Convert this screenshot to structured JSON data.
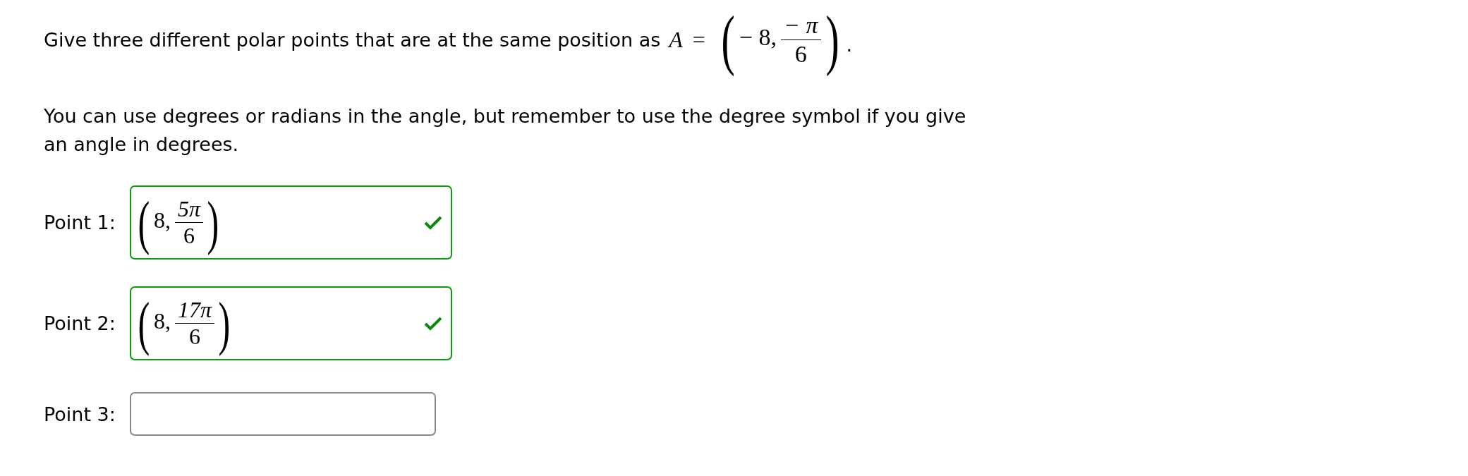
{
  "question": {
    "text": "Give three different polar points that are at the same position as",
    "math": {
      "variable": "A",
      "relation": "=",
      "open": "(",
      "before": "− 8,",
      "numerator": "− π",
      "denominator": "6",
      "close": ")"
    },
    "end": "."
  },
  "note": "You can use degrees or radians in the angle, but remember to use the degree symbol if you give an angle in degrees.",
  "answers": [
    {
      "label": "Point 1:",
      "correct": true,
      "value": {
        "open": "(",
        "before": "8,",
        "numerator": "5π",
        "denominator": "6",
        "close": ")"
      }
    },
    {
      "label": "Point 2:",
      "correct": true,
      "value": {
        "open": "(",
        "before": "8,",
        "numerator": "17π",
        "denominator": "6",
        "close": ")"
      }
    },
    {
      "label": "Point 3:",
      "correct": false
    }
  ]
}
